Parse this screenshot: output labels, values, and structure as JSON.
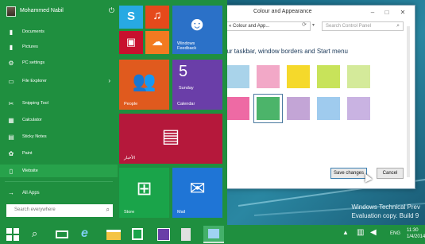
{
  "user": {
    "name": "Mohammed Nabil"
  },
  "menu_items": [
    {
      "label": "Documents",
      "icon": "folder-icon",
      "arrow": false
    },
    {
      "label": "Pictures",
      "icon": "folder-icon",
      "arrow": false
    },
    {
      "label": "PC settings",
      "icon": "gear-icon",
      "arrow": false
    },
    {
      "label": "File Explorer",
      "icon": "folder-icon",
      "arrow": true
    },
    {
      "label": "Snipping Tool",
      "icon": "scissors-icon",
      "arrow": false
    },
    {
      "label": "Calculator",
      "icon": "calculator-icon",
      "arrow": false
    },
    {
      "label": "Sticky Notes",
      "icon": "note-icon",
      "arrow": false
    },
    {
      "label": "Paint",
      "icon": "palette-icon",
      "arrow": false
    },
    {
      "label": "Website",
      "icon": "document-icon",
      "arrow": false
    }
  ],
  "all_apps_label": "All Apps",
  "search": {
    "placeholder": "Search everywhere"
  },
  "tiles": {
    "windows_feedback": "Windows Feedback",
    "people": "People",
    "calendar_day": "5",
    "calendar_weekday": "Sunday",
    "calendar": "Calendar",
    "news": "الأخبار",
    "store": "Store",
    "mail": "Mail"
  },
  "control_panel": {
    "title": "Colour and Appearance",
    "address": "« Colour and App...",
    "search_placeholder": "Search Control Panel",
    "heading": "our taskbar, window borders and Start menu",
    "swatches_row1": [
      "#a9d3ea",
      "#f2a8c7",
      "#f5d92b",
      "#c8e35a",
      "#d4ea9a"
    ],
    "swatches_row2": [
      "#ee6aa4",
      "#4cb46a",
      "#c3a5d6",
      "#9fcbee",
      "#c9b3e2"
    ],
    "selected_swatch": "row2-1",
    "save_label": "Save changes",
    "cancel_label": "Cancel"
  },
  "watermark": {
    "line1": "Windows Technical Prev",
    "line2": "Evaluation copy. Build 9"
  },
  "taskbar": {
    "lang": "ENG",
    "time": "11:30",
    "date": "1/4/2014"
  },
  "colors": {
    "start_green": "#1f8f3f",
    "skype": "#27a9e3",
    "music": "#e5491b",
    "video": "#c8102e",
    "onedrive": "#f27a21",
    "feedback": "#2b71c8",
    "people": "#e05a1e",
    "calendar": "#6a3ea8",
    "news": "#b5183b",
    "store": "#1aa44a",
    "mail": "#1f75d6",
    "taskbar": "#1f8f3f"
  }
}
